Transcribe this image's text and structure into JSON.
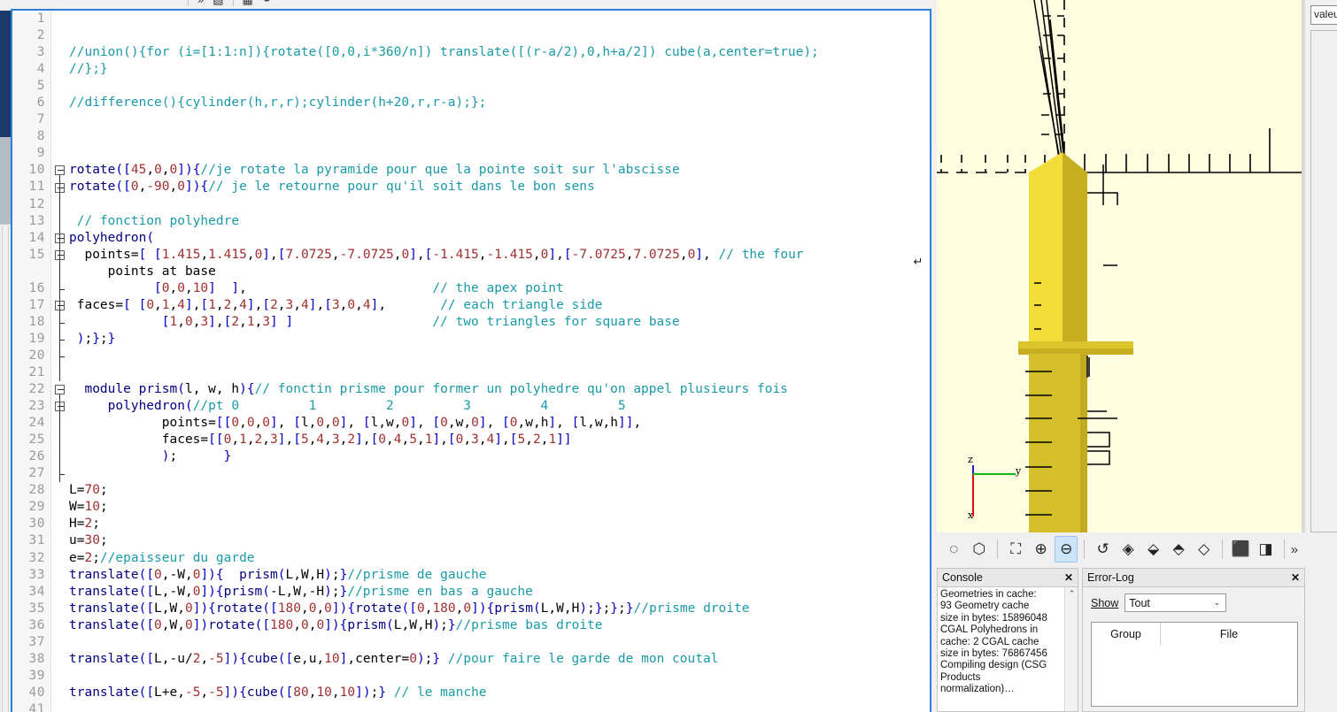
{
  "app": {
    "name": "OpenSCAD"
  },
  "editor": {
    "first_line": 1,
    "lines": [
      {
        "n": 1,
        "text": ""
      },
      {
        "n": 2,
        "text": ""
      },
      {
        "n": 3,
        "text": "//union(){for (i=[1:1:n]){rotate([0,0,i*360/n]) translate([(r-a/2),0,h+a/2]) cube(a,center=true);"
      },
      {
        "n": 4,
        "text": "//};}"
      },
      {
        "n": 5,
        "text": ""
      },
      {
        "n": 6,
        "text": "//difference(){cylinder(h,r,r);cylinder(h+20,r,r-a);};"
      },
      {
        "n": 7,
        "text": ""
      },
      {
        "n": 8,
        "text": ""
      },
      {
        "n": 9,
        "text": ""
      },
      {
        "n": 10,
        "text": "rotate([45,0,0]){//je rotate la pyramide pour que la pointe soit sur l'abscisse"
      },
      {
        "n": 11,
        "text": "rotate([0,-90,0]){// je le retourne pour qu'il soit dans le bon sens"
      },
      {
        "n": 12,
        "text": ""
      },
      {
        "n": 13,
        "text": " // fonction polyhedre"
      },
      {
        "n": 14,
        "text": "polyhedron("
      },
      {
        "n": 15,
        "text": "  points=[ [1.415,1.415,0],[7.0725,-7.0725,0],[-1.415,-1.415,0],[-7.0725,7.0725,0], // the four"
      },
      {
        "n": "",
        "text": "     points at base"
      },
      {
        "n": 16,
        "text": "           [0,0,10]  ],                        // the apex point"
      },
      {
        "n": 17,
        "text": " faces=[ [0,1,4],[1,2,4],[2,3,4],[3,0,4],       // each triangle side"
      },
      {
        "n": 18,
        "text": "            [1,0,3],[2,1,3] ]                  // two triangles for square base"
      },
      {
        "n": 19,
        "text": " );};}"
      },
      {
        "n": 20,
        "text": ""
      },
      {
        "n": 21,
        "text": ""
      },
      {
        "n": 22,
        "text": "  module prism(l, w, h){// fonctin prisme pour former un polyhedre qu'on appel plusieurs fois"
      },
      {
        "n": 23,
        "text": "     polyhedron(//pt 0         1         2         3         4         5"
      },
      {
        "n": 24,
        "text": "            points=[[0,0,0], [l,0,0], [l,w,0], [0,w,0], [0,w,h], [l,w,h]],"
      },
      {
        "n": 25,
        "text": "            faces=[[0,1,2,3],[5,4,3,2],[0,4,5,1],[0,3,4],[5,2,1]]"
      },
      {
        "n": 26,
        "text": "            );      }"
      },
      {
        "n": 27,
        "text": ""
      },
      {
        "n": 28,
        "text": "L=70;"
      },
      {
        "n": 29,
        "text": "W=10;"
      },
      {
        "n": 30,
        "text": "H=2;"
      },
      {
        "n": 31,
        "text": "u=30;"
      },
      {
        "n": 32,
        "text": "e=2;//epaisseur du garde"
      },
      {
        "n": 33,
        "text": "translate([0,-W,0]){  prism(L,W,H);}//prisme de gauche"
      },
      {
        "n": 34,
        "text": "translate([L,-W,0]){prism(-L,W,-H);}//prisme en bas a gauche"
      },
      {
        "n": 35,
        "text": "translate([L,W,0]){rotate([180,0,0]){rotate([0,180,0]){prism(L,W,H);};};}//prisme droite"
      },
      {
        "n": 36,
        "text": "translate([0,W,0])rotate([180,0,0]){prism(L,W,H);}//prisme bas droite"
      },
      {
        "n": 37,
        "text": ""
      },
      {
        "n": 38,
        "text": "translate([L,-u/2,-5]){cube([e,u,10],center=0);} //pour faire le garde de mon coutal"
      },
      {
        "n": 39,
        "text": ""
      },
      {
        "n": 40,
        "text": "translate([L+e,-5,-5]){cube([80,10,10]);} // le manche"
      },
      {
        "n": 41,
        "text": ""
      }
    ],
    "wrap_marker": "↵"
  },
  "viewport": {
    "background_color": "#fffee0",
    "model_color": "#e8d133",
    "model_shadow_color": "#c2ab1f",
    "axis": {
      "x_label": "x",
      "y_label": "y",
      "z_label": "z",
      "x_color": "#dd1111",
      "y_color": "#11bb11",
      "z_color": "#2222cc"
    }
  },
  "viewport_toolbar": {
    "buttons": [
      {
        "name": "animate-icon",
        "glyph": "◌",
        "active": false
      },
      {
        "name": "view-all-icon",
        "glyph": "⬡",
        "active": false
      },
      {
        "name": "zoom-fit-icon",
        "glyph": "⛶",
        "active": false
      },
      {
        "name": "zoom-in-icon",
        "glyph": "⊕",
        "active": false
      },
      {
        "name": "zoom-out-icon",
        "glyph": "⊖",
        "active": true
      },
      {
        "name": "reset-view-icon",
        "glyph": "↺",
        "active": false
      },
      {
        "name": "view-right-icon",
        "glyph": "◈",
        "active": false
      },
      {
        "name": "view-top-icon",
        "glyph": "⬙",
        "active": false
      },
      {
        "name": "view-bottom-icon",
        "glyph": "⬘",
        "active": false
      },
      {
        "name": "view-left-icon",
        "glyph": "◇",
        "active": false
      },
      {
        "name": "view-front-icon",
        "glyph": "⬛",
        "active": false
      },
      {
        "name": "view-back-icon",
        "glyph": "◨",
        "active": false
      }
    ],
    "overflow_label": "»"
  },
  "console": {
    "title": "Console",
    "close_label": "✕",
    "text": "Geometries in cache: 93 Geometry cache size in bytes: 15896048 CGAL Polyhedrons in cache: 2 CGAL cache size in bytes: 76867456 Compiling design (CSG Products normalization)…",
    "scroll_up_glyph": "⌃"
  },
  "error_log": {
    "title": "Error-Log",
    "close_label": "✕",
    "show_label": "Show",
    "filter_value": "Tout",
    "chevron": "⌄",
    "columns": [
      "Group",
      "File"
    ],
    "rows": []
  },
  "right_dock": {
    "field_value": "valeu"
  }
}
